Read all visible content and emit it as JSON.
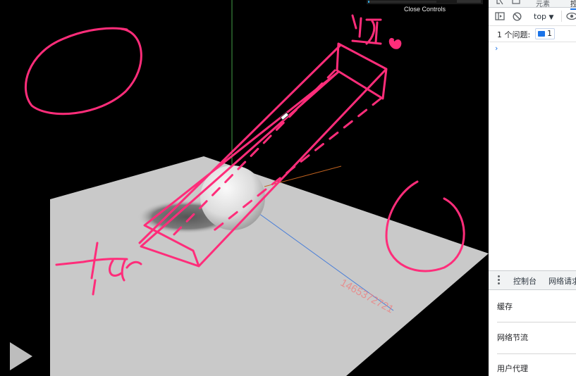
{
  "viewer": {
    "close_controls_label": "Close Controls",
    "watermark": "1465372721",
    "play_icon": "play-icon"
  },
  "annotations": {
    "near_label": "近",
    "far_label": "fur"
  },
  "colors": {
    "annotation": "#ff2d7a",
    "ground": "#c9c9c9",
    "sphere": "#e8e8e8",
    "axis_y": "#43a047",
    "axis_x": "#c0621f",
    "axis_z": "#4a7fd8",
    "devtools_accent": "#1a73e8",
    "watermark": "#f07c7c"
  },
  "devtools": {
    "tabs": [
      "元素",
      "控"
    ],
    "toolbar": {
      "context": "top",
      "icons": [
        "sidebar-toggle-icon",
        "clear-console-icon",
        "eye-icon"
      ]
    },
    "issues": {
      "text": "1 个问题:",
      "count": "1"
    },
    "console_prompt": "›",
    "drawer": {
      "tabs": [
        "控制台",
        "网络请求"
      ]
    },
    "conditions": [
      "缓存",
      "网络节流",
      "用户代理"
    ]
  }
}
